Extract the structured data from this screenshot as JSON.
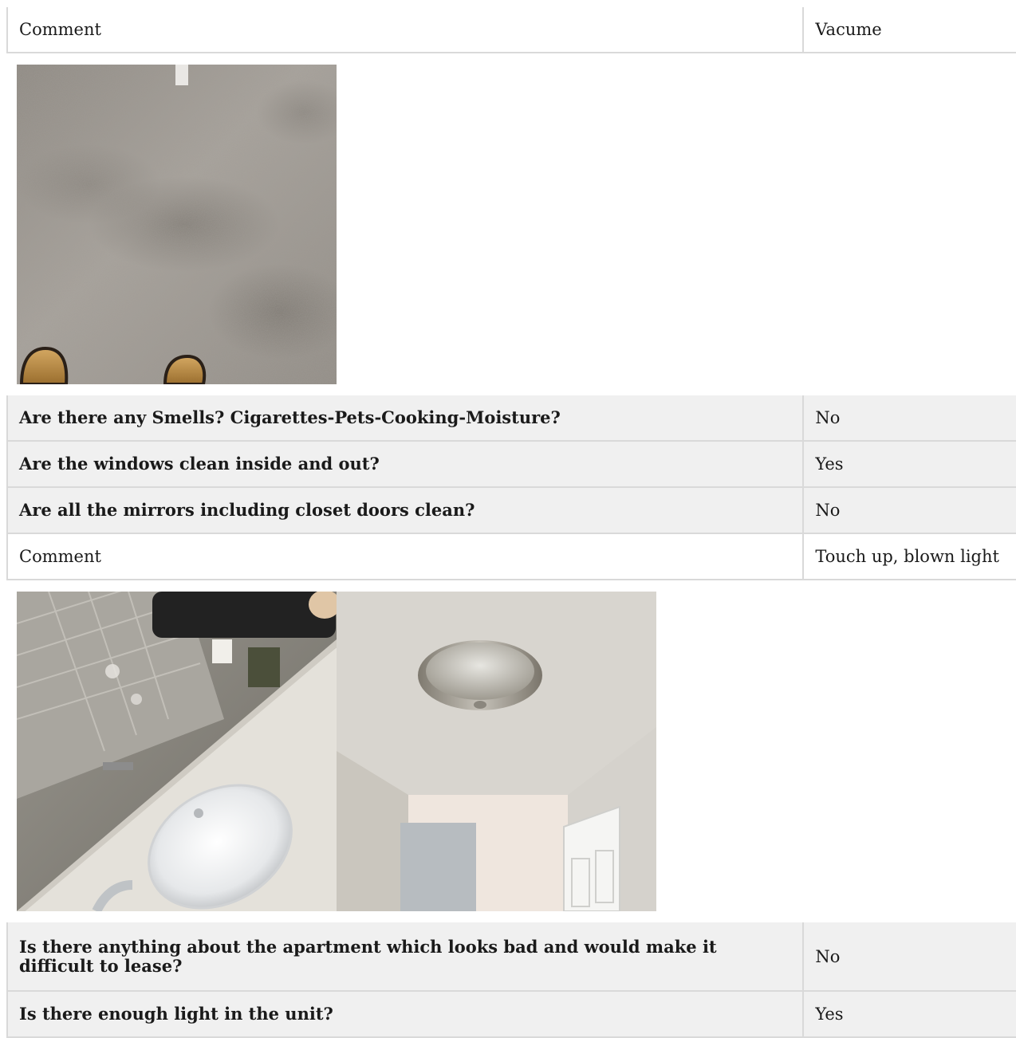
{
  "block1": {
    "comment": {
      "label": "Comment",
      "value": "Vacume"
    },
    "photos": [
      {
        "icon": "carpet-photo"
      }
    ]
  },
  "block2": {
    "rows": [
      {
        "question": "Are there any Smells? Cigarettes-Pets-Cooking-Moisture?",
        "answer": "No"
      },
      {
        "question": "Are the windows clean inside and out?",
        "answer": "Yes"
      },
      {
        "question": "Are all the mirrors including closet doors clean?",
        "answer": "No"
      }
    ],
    "comment": {
      "label": "Comment",
      "value": "Touch up, blown light"
    },
    "photos": [
      {
        "icon": "bathroom-sink-photo"
      },
      {
        "icon": "ceiling-light-photo"
      }
    ]
  },
  "block3": {
    "rows": [
      {
        "question": "Is there anything about the apartment which looks bad and would make it difficult to lease?",
        "answer": "No"
      },
      {
        "question": "Is there enough light in the unit?",
        "answer": "Yes"
      }
    ]
  }
}
